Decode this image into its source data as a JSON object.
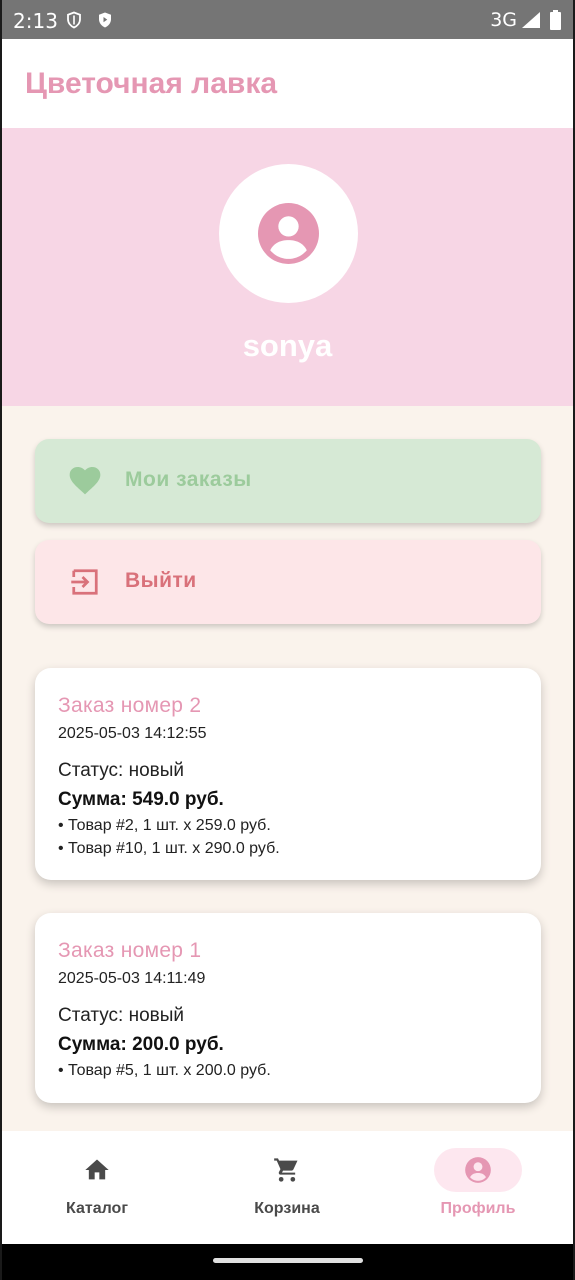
{
  "status_bar": {
    "time": "2:13",
    "network": "3G",
    "icons": [
      "shield-icon",
      "play-protect-icon",
      "signal-icon",
      "battery-icon"
    ]
  },
  "app_bar": {
    "title": "Цветочная лавка"
  },
  "profile": {
    "username": "sonya",
    "avatar_icon": "account-circle-icon"
  },
  "actions": {
    "orders": {
      "label": "Мои заказы",
      "icon": "heart-icon"
    },
    "logout": {
      "label": "Выйти",
      "icon": "logout-icon"
    }
  },
  "orders": [
    {
      "title": "Заказ номер 2",
      "date": "2025-05-03 14:12:55",
      "status": "Статус: новый",
      "sum": "Сумма: 549.0 руб.",
      "items": [
        "• Товар #2, 1 шт. x 259.0 руб.",
        "• Товар #10, 1 шт. x 290.0 руб."
      ]
    },
    {
      "title": "Заказ номер 1",
      "date": "2025-05-03 14:11:49",
      "status": "Статус: новый",
      "sum": "Сумма: 200.0 руб.",
      "items": [
        "• Товар #5, 1 шт. x 200.0 руб."
      ]
    }
  ],
  "bottom_nav": {
    "items": [
      {
        "label": "Каталог",
        "icon": "home-icon",
        "active": false
      },
      {
        "label": "Корзина",
        "icon": "cart-icon",
        "active": false
      },
      {
        "label": "Профиль",
        "icon": "account-circle-icon",
        "active": true
      }
    ]
  },
  "colors": {
    "accent_pink": "#e597b3",
    "header_pink": "#f7d6e5",
    "orders_green": "#d6e9d5",
    "logout_pink": "#fde6e8",
    "background": "#faf3ec"
  }
}
